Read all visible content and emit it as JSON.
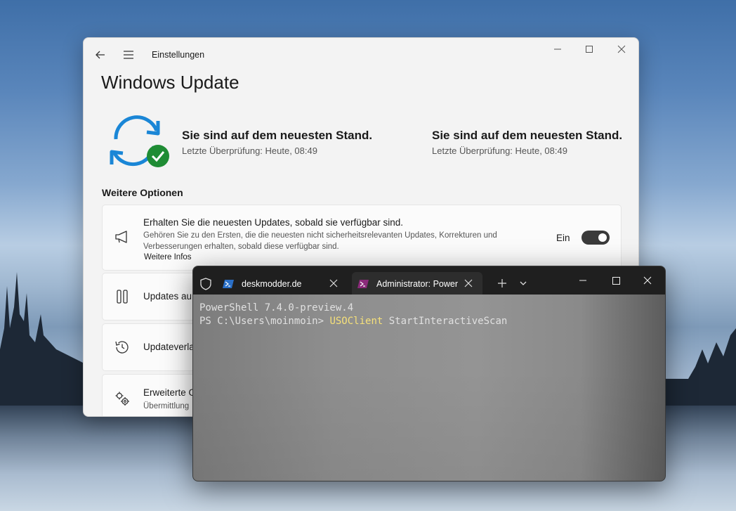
{
  "settings": {
    "app_title": "Einstellungen",
    "page_title": "Windows Update",
    "status_title": "Sie sind auf dem neuesten Stand.",
    "status_sub": "Letzte Überprüfung: Heute, 08:49",
    "section_title": "Weitere Optionen",
    "cards": [
      {
        "title": "Erhalten Sie die neuesten Updates, sobald sie verfügbar sind.",
        "desc": "Gehören Sie zu den Ersten, die die neuesten nicht sicherheitsrelevanten Updates, Korrekturen und Verbesserungen erhalten, sobald diese verfügbar sind.",
        "link": "Weitere Infos",
        "toggle_label": "Ein",
        "toggle_on": true,
        "icon": "megaphone-icon"
      },
      {
        "title": "Updates au",
        "icon": "pause-icon"
      },
      {
        "title": "Updateverla",
        "icon": "history-icon"
      },
      {
        "title": "Erweiterte O",
        "sub": "Übermittlung",
        "icon": "gears-icon"
      }
    ]
  },
  "terminal": {
    "tabs": [
      {
        "label": "deskmodder.de",
        "icon": "powershell-icon"
      },
      {
        "label": "Administrator: Power",
        "icon": "powershell-preview-icon",
        "active": true
      }
    ],
    "line1": "PowerShell 7.4.0-preview.4",
    "prompt": "PS C:\\Users\\moinmoin> ",
    "command": "USOClient",
    "args": " StartInteractiveScan"
  },
  "colors": {
    "accent_blue": "#1a86d6",
    "check_green": "#1f8c34",
    "command_yellow": "#f5e07a"
  }
}
